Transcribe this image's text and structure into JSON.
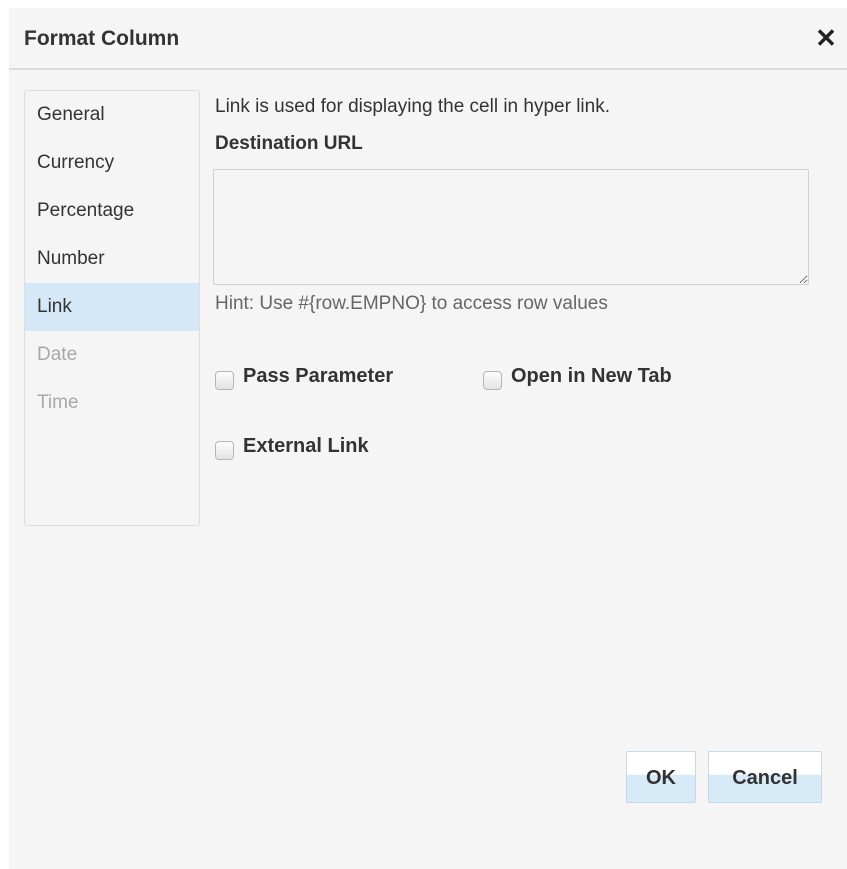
{
  "dialog": {
    "title": "Format Column",
    "close_glyph": "✕"
  },
  "nav": {
    "items": [
      {
        "label": "General",
        "state": "normal"
      },
      {
        "label": "Currency",
        "state": "normal"
      },
      {
        "label": "Percentage",
        "state": "normal"
      },
      {
        "label": "Number",
        "state": "normal"
      },
      {
        "label": "Link",
        "state": "selected"
      },
      {
        "label": "Date",
        "state": "disabled"
      },
      {
        "label": "Time",
        "state": "disabled"
      }
    ]
  },
  "link_panel": {
    "description": "Link is used for displaying the cell in hyper link.",
    "destination_label": "Destination URL",
    "destination_value": "",
    "hint": "Hint: Use #{row.EMPNO} to access row values",
    "options": {
      "pass_parameter": {
        "label": "Pass Parameter",
        "checked": false
      },
      "open_new_tab": {
        "label": "Open in New Tab",
        "checked": false
      },
      "external_link": {
        "label": "External Link",
        "checked": false
      }
    }
  },
  "footer": {
    "ok_label": "OK",
    "cancel_label": "Cancel"
  },
  "colors": {
    "dialog_bg": "#f5f5f5",
    "selected_item_bg": "#d4e8f7",
    "disabled_text": "#a8a8a8",
    "button_accent": "#d7eaf7"
  }
}
